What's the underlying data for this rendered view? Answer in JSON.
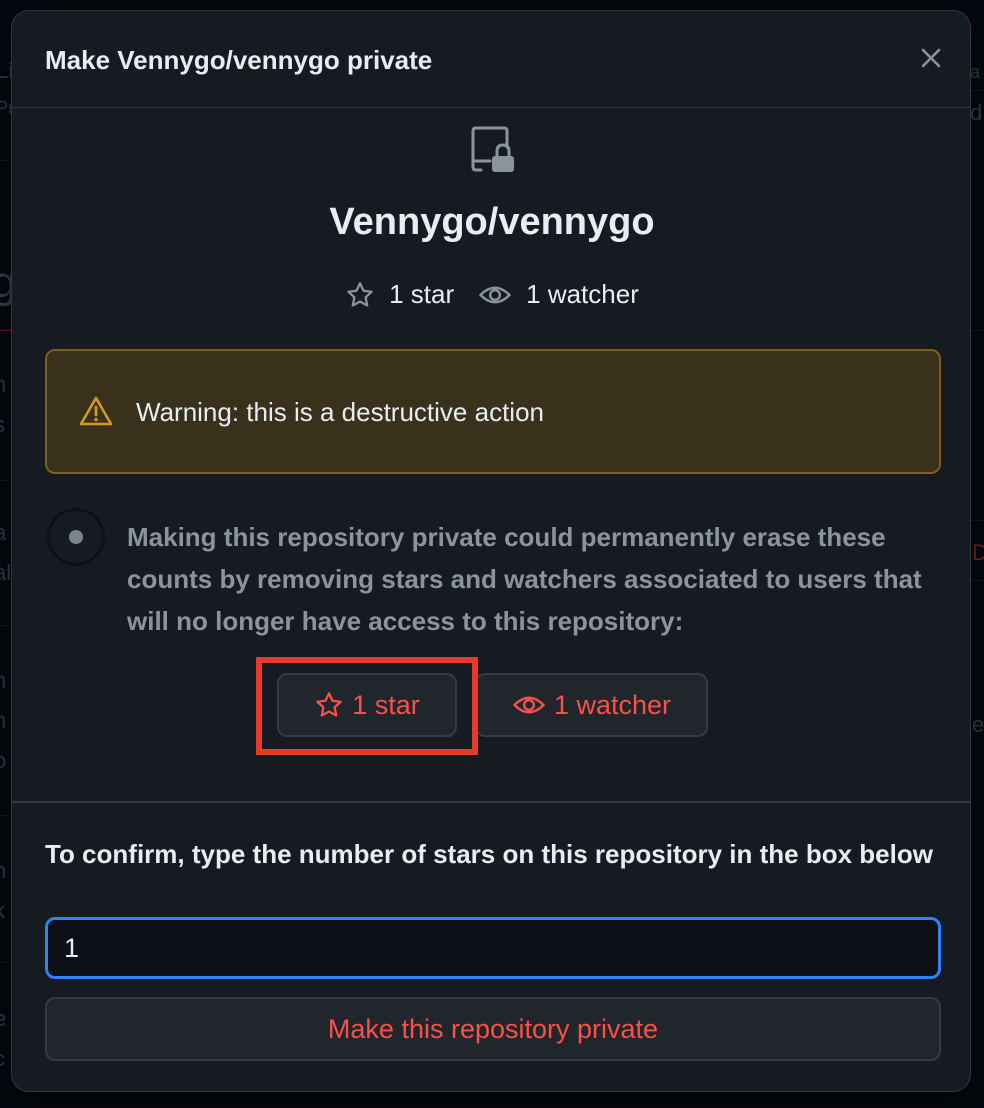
{
  "dialog": {
    "title": "Make Vennygo/vennygo private",
    "close_icon": "close-icon"
  },
  "repo": {
    "icon": "repo-locked-icon",
    "name": "Vennygo/vennygo",
    "stars_label": "1 star",
    "watchers_label": "1 watcher"
  },
  "warning": {
    "icon": "alert-icon",
    "text": "Warning: this is a destructive action"
  },
  "step": {
    "text": "Making this repository private could permanently erase these counts by removing stars and watchers associated to users that will no longer have access to this repository:",
    "star_button": "1 star",
    "watcher_button": "1 watcher"
  },
  "confirm": {
    "label": "To confirm, type the number of stars on this repository in the box below",
    "input_value": "1",
    "submit_label": "Make this repository private"
  },
  "colors": {
    "danger": "#f85149",
    "focus": "#2f81f7",
    "warning_bg": "#3a311c",
    "warning_border": "#7d5f21",
    "annotation": "#e8392a"
  }
}
